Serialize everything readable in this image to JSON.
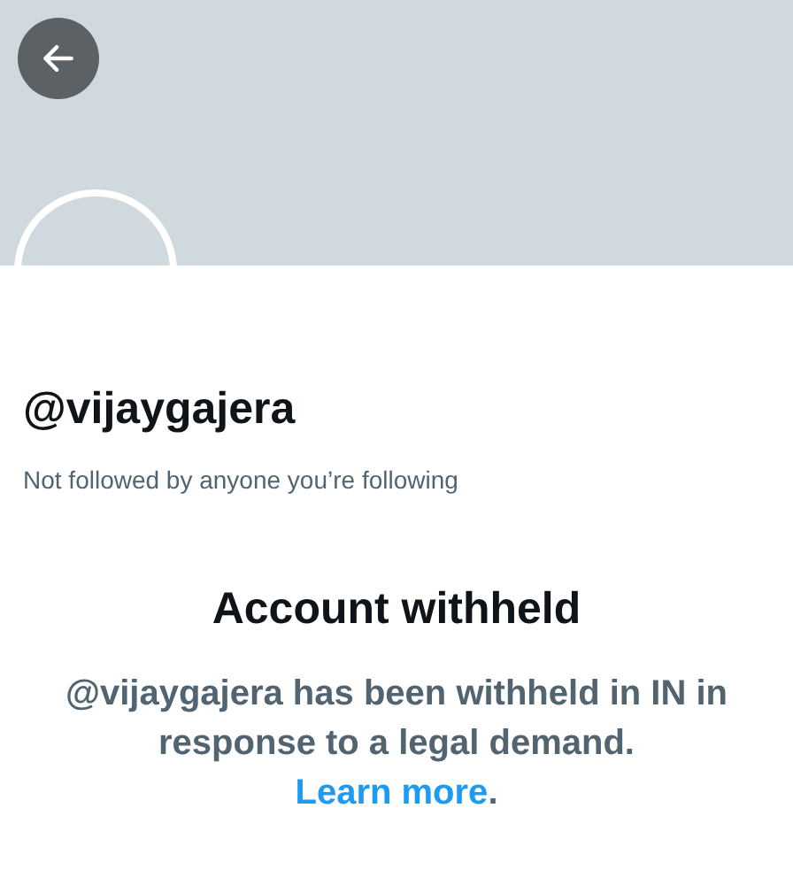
{
  "profile": {
    "username": "@vijaygajera",
    "followers_note": "Not followed by anyone you’re following"
  },
  "notice": {
    "title": "Account withheld",
    "message": "@vijaygajera has been withheld in IN in response to a legal demand.",
    "link": "Learn more",
    "end": "."
  }
}
